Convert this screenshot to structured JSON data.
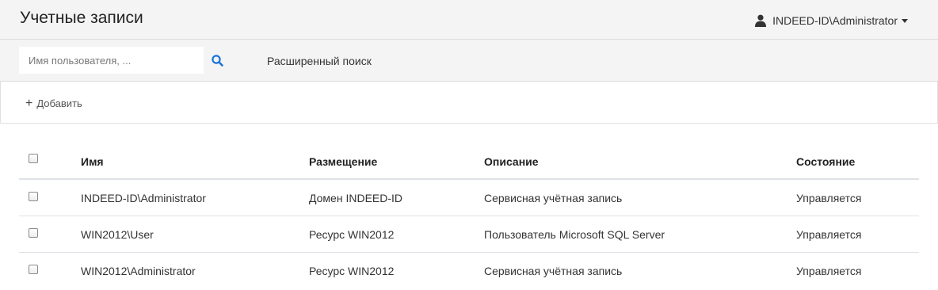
{
  "header": {
    "title": "Учетные записи",
    "user": "INDEED-ID\\Administrator"
  },
  "search": {
    "placeholder": "Имя пользователя, ...",
    "value": "",
    "advanced_label": "Расширенный поиск"
  },
  "toolbar": {
    "add_label": "Добавить"
  },
  "table": {
    "columns": [
      "Имя",
      "Размещение",
      "Описание",
      "Состояние"
    ],
    "rows": [
      {
        "name": "INDEED-ID\\Administrator",
        "location": "Домен INDEED-ID",
        "description": "Сервисная учётная запись",
        "state": "Управляется"
      },
      {
        "name": "WIN2012\\User",
        "location": "Ресурс WIN2012",
        "description": "Пользователь Microsoft SQL Server",
        "state": "Управляется"
      },
      {
        "name": "WIN2012\\Administrator",
        "location": "Ресурс WIN2012",
        "description": "Сервисная учётная запись",
        "state": "Управляется"
      }
    ]
  },
  "icons": {
    "user": "user-icon",
    "search": "search-icon",
    "add": "plus-icon",
    "dropdown": "caret-down-icon"
  },
  "colors": {
    "accent": "#1a73d9",
    "header_bg": "#f4f4f5"
  }
}
